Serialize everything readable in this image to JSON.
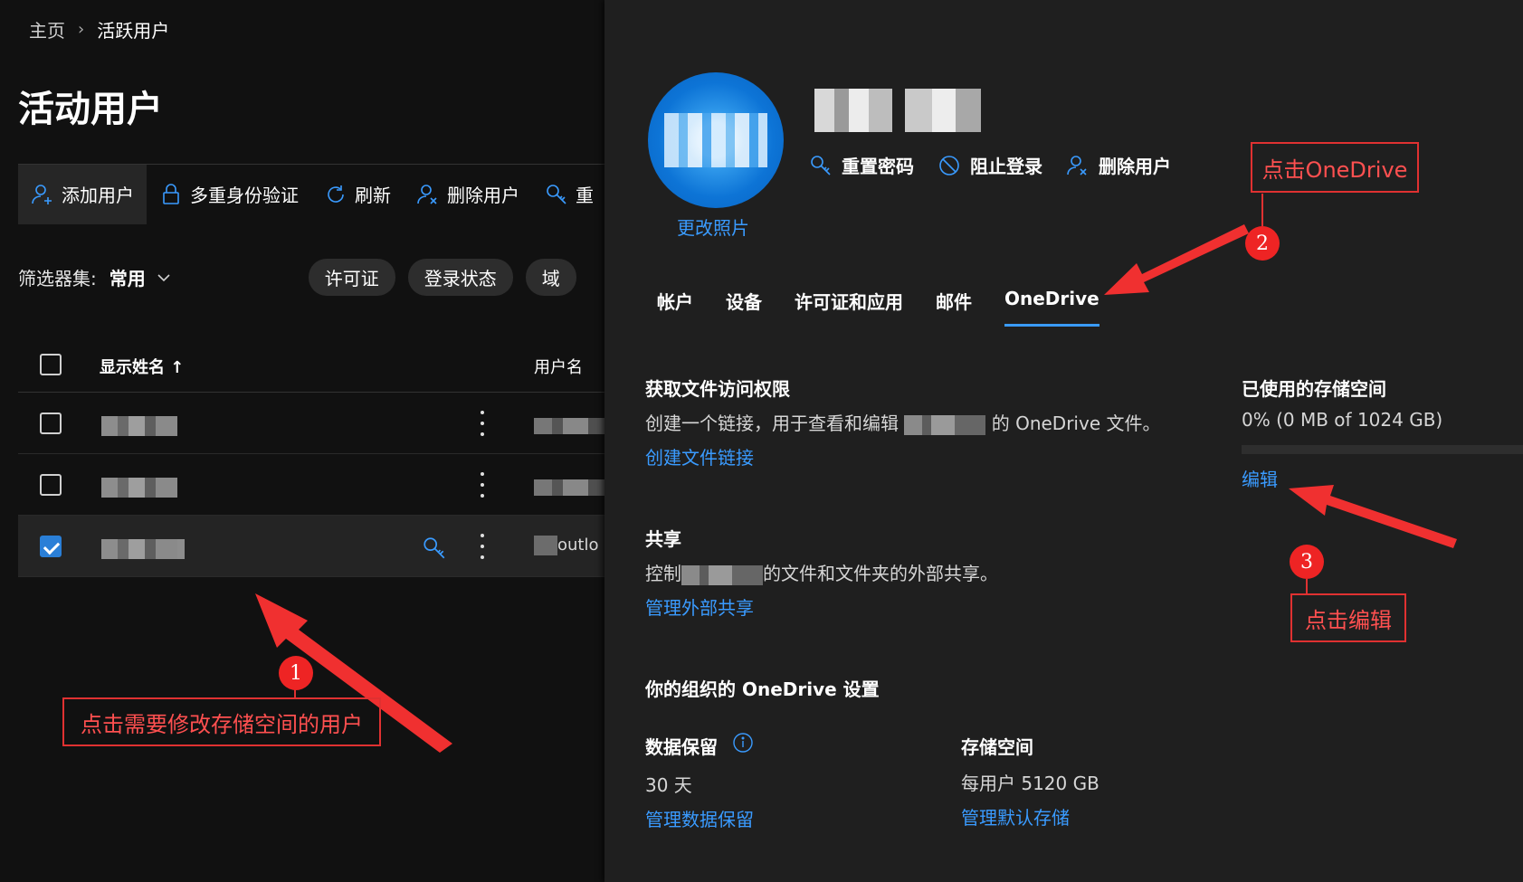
{
  "breadcrumb": {
    "home": "主页",
    "current": "活跃用户"
  },
  "page_title": "活动用户",
  "toolbar": {
    "add_user": "添加用户",
    "mfa": "多重身份验证",
    "refresh": "刷新",
    "delete_user": "删除用户",
    "reset_truncated": "重"
  },
  "filter": {
    "label": "筛选器集:",
    "value": "常用",
    "pills": [
      "许可证",
      "登录状态",
      "域"
    ]
  },
  "table": {
    "col_display_name": "显示姓名",
    "sort_indicator": "↑",
    "col_username": "用户名",
    "selected_row_user_suffix": "outlo"
  },
  "panel": {
    "change_photo": "更改照片",
    "actions": {
      "reset_password": "重置密码",
      "block_signin": "阻止登录",
      "delete_user": "删除用户"
    },
    "tabs": [
      "帐户",
      "设备",
      "许可证和应用",
      "邮件",
      "OneDrive"
    ],
    "active_tab": "OneDrive",
    "file_access": {
      "heading": "获取文件访问权限",
      "text_before": "创建一个链接，用于查看和编辑",
      "text_after": "的 OneDrive 文件。",
      "link": "创建文件链接"
    },
    "storage_used": {
      "heading": "已使用的存储空间",
      "value": "0% (0 MB of 1024 GB)",
      "percent": 0,
      "link": "编辑"
    },
    "sharing": {
      "heading": "共享",
      "text_before": "控制",
      "text_after": "的文件和文件夹的外部共享。",
      "link": "管理外部共享"
    },
    "org_settings": {
      "heading": "你的组织的 OneDrive 设置",
      "retention": {
        "label": "数据保留",
        "value": "30 天",
        "link": "管理数据保留"
      },
      "storage": {
        "label": "存储空间",
        "value": "每用户 5120 GB",
        "link": "管理默认存储"
      }
    }
  },
  "annotations": {
    "step1": {
      "number": "1",
      "label": "点击需要修改存储空间的用户"
    },
    "step2": {
      "number": "2",
      "label": "点击OneDrive"
    },
    "step3": {
      "number": "3",
      "label": "点击编辑"
    }
  },
  "colors": {
    "accent": "#3a9bff",
    "annotation": "#e03131",
    "panel_bg": "#1f1f1f",
    "page_bg": "#111111"
  }
}
